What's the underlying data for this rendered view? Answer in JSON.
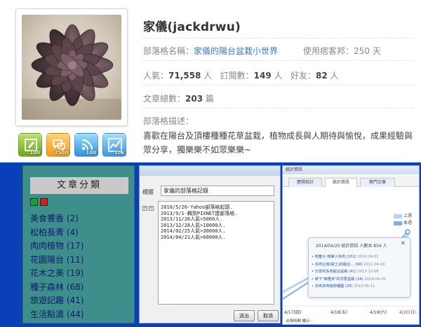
{
  "profile": {
    "username": "家儀(jackdrwu)",
    "blog_name_label": "部落格名稱：",
    "blog_name": "家儀的陽台盆栽小世界",
    "usage_label": "使用痞客邦：",
    "usage_value": "250 天",
    "popularity_label": "人氣：",
    "popularity_value": "71,558",
    "popularity_unit": "人",
    "subscribers_label": "訂閱數：",
    "subscribers_value": "149",
    "subscribers_unit": "人",
    "friends_label": "好友：",
    "friends_value": "82",
    "friends_unit": "人",
    "articles_label": "文章總數：",
    "articles_value": "203",
    "articles_unit": "篇",
    "desc_label": "部落格描述：",
    "description": "喜歡在陽台及頂樓種種花草盆栽，植物成長與人期待與愉悅，成果經驗與眾分享，獨樂樂不如眾樂樂~"
  },
  "badges": [
    {
      "icon": "note-icon",
      "count": "100",
      "color": "#7bb52a"
    },
    {
      "icon": "comment-icon",
      "count": "2500",
      "color": "#f3a21a"
    },
    {
      "icon": "rss-icon",
      "count": "100",
      "color": "#2f96e0"
    },
    {
      "icon": "chart-icon",
      "count": "10k",
      "color": "#3a97df"
    }
  ],
  "sidebar": {
    "title": "文章分類",
    "categories": [
      "美食饗香 (2)",
      "松柏長青 (4)",
      "肉肉植物 (17)",
      "花園陽台 (11)",
      "花木之美 (19)",
      "種子森林 (68)",
      "旅遊記趣 (41)",
      "生活點滴 (44)"
    ]
  },
  "dialog": {
    "field_label": "標題",
    "field_value": "家儀的部落格記錄",
    "lines": [
      "2010/5/20-Yahoo部落格起頭.",
      "2013/9/1-轉到PIXNET建部落格.",
      "2013/11/20人氣>5000人.",
      "2013/12/28人氣>10000人.",
      "2014/02/25人氣>30000人.",
      "2014/04/21人氣>60000人."
    ],
    "confirm_label": "送出",
    "cancel_label": "取消"
  },
  "stats": {
    "header": "統計資訊",
    "tabs": [
      "歷程統計",
      "統計資訊",
      "熱門文章"
    ],
    "legend": [
      "上週",
      "本週"
    ],
    "legend_colors": [
      "#b9d3ee",
      "#7fb1e3"
    ],
    "popup_title": "2014/04/20 統計資訊 人數共 856 人",
    "popup_items": [
      {
        "title": "熊童子-熊掌小多肉",
        "count": "(101)",
        "date": "2010-09-02"
      },
      {
        "title": "多肉台灣(開土)的組合...",
        "count": "(90)",
        "date": "2011-04-16"
      },
      {
        "title": "分享的多肉組合盆栽",
        "count": "(41)",
        "date": "2013-12-08"
      },
      {
        "title": "被下\"萊種多\"的洋蔥盆栽",
        "count": "(34)",
        "date": "2014-04-20"
      },
      {
        "title": "多肉多肉植物種圖",
        "count": "(25)",
        "date": "2010-05-11"
      }
    ],
    "x_labels": [
      "4/17(四)",
      "4/18(五)",
      "4/19(六)",
      "4/20(日)"
    ],
    "footer": "台灣時間 顯示 ·"
  }
}
